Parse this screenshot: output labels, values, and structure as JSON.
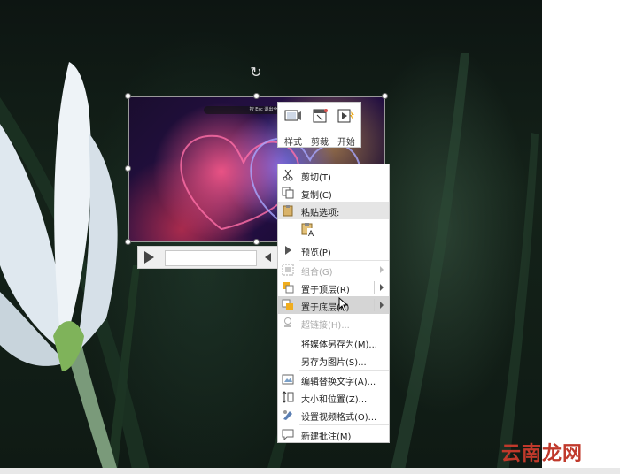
{
  "mini_toolbar": {
    "style_label": "样式",
    "trim_label": "剪裁",
    "start_label": "开始"
  },
  "context_menu": {
    "items": [
      {
        "label": "剪切(T)",
        "icon": "scissors-icon"
      },
      {
        "label": "复制(C)",
        "icon": "copy-icon"
      },
      {
        "label": "粘贴选项:",
        "icon": "clipboard-icon"
      },
      {
        "label": "预览(P)",
        "icon": "play-icon"
      },
      {
        "label": "组合(G)",
        "icon": "group-icon",
        "disabled": true
      },
      {
        "label": "置于顶层(R)",
        "icon": "bring-to-front-icon"
      },
      {
        "label": "置于底层(K)",
        "icon": "send-to-back-icon"
      },
      {
        "label": "超链接(H)...",
        "icon": "hyperlink-icon",
        "disabled": true
      },
      {
        "label": "将媒体另存为(M)...",
        "icon": ""
      },
      {
        "label": "另存为图片(S)...",
        "icon": ""
      },
      {
        "label": "编辑替换文字(A)...",
        "icon": "alt-text-icon"
      },
      {
        "label": "大小和位置(Z)...",
        "icon": "size-position-icon"
      },
      {
        "label": "设置视频格式(O)...",
        "icon": "format-video-icon"
      },
      {
        "label": "新建批注(M)",
        "icon": "comment-icon"
      }
    ]
  },
  "video": {
    "top_caption": "按 Esc 退出全屏模式"
  },
  "watermark": "云南龙网",
  "colors": {
    "menu_highlight": "#d5d5d5",
    "menu_header": "#e5e5e5",
    "watermark": "#c0392b"
  }
}
